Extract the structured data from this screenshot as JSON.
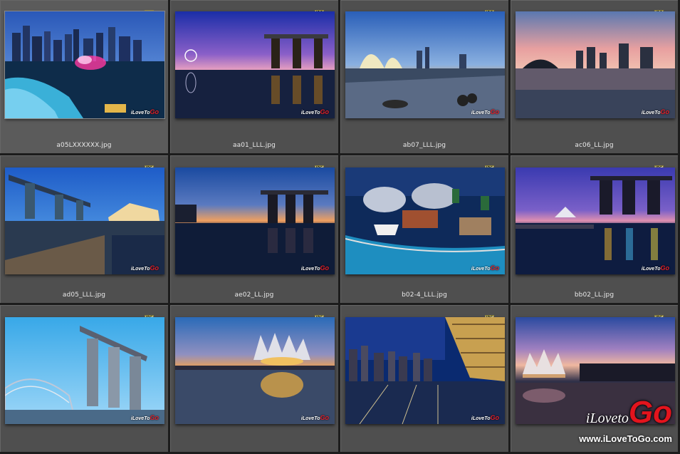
{
  "badge_label": "JPG",
  "watermark": {
    "prefix": "iLoveTo",
    "go": "Go"
  },
  "thumbnails": [
    {
      "filename": "a05LXXXXXX.jpg",
      "selected": true
    },
    {
      "filename": "aa01_LLL.jpg"
    },
    {
      "filename": "ab07_LLL.jpg"
    },
    {
      "filename": "ac06_LL.jpg"
    },
    {
      "filename": "ad05_LLL.jpg"
    },
    {
      "filename": "ae02_LL.jpg"
    },
    {
      "filename": "b02-4_LLL.jpg"
    },
    {
      "filename": "bb02_LL.jpg"
    },
    {
      "filename": ""
    },
    {
      "filename": ""
    },
    {
      "filename": ""
    },
    {
      "filename": ""
    }
  ],
  "brand": {
    "logo_prefix": "iLoveto",
    "logo_go": "Go",
    "url": "www.iLoveToGo.com"
  },
  "colors": {
    "background": "#262626",
    "cell": "#4f4f4f",
    "caption_text": "#e8e8e8",
    "brand_red": "#e3141d"
  }
}
